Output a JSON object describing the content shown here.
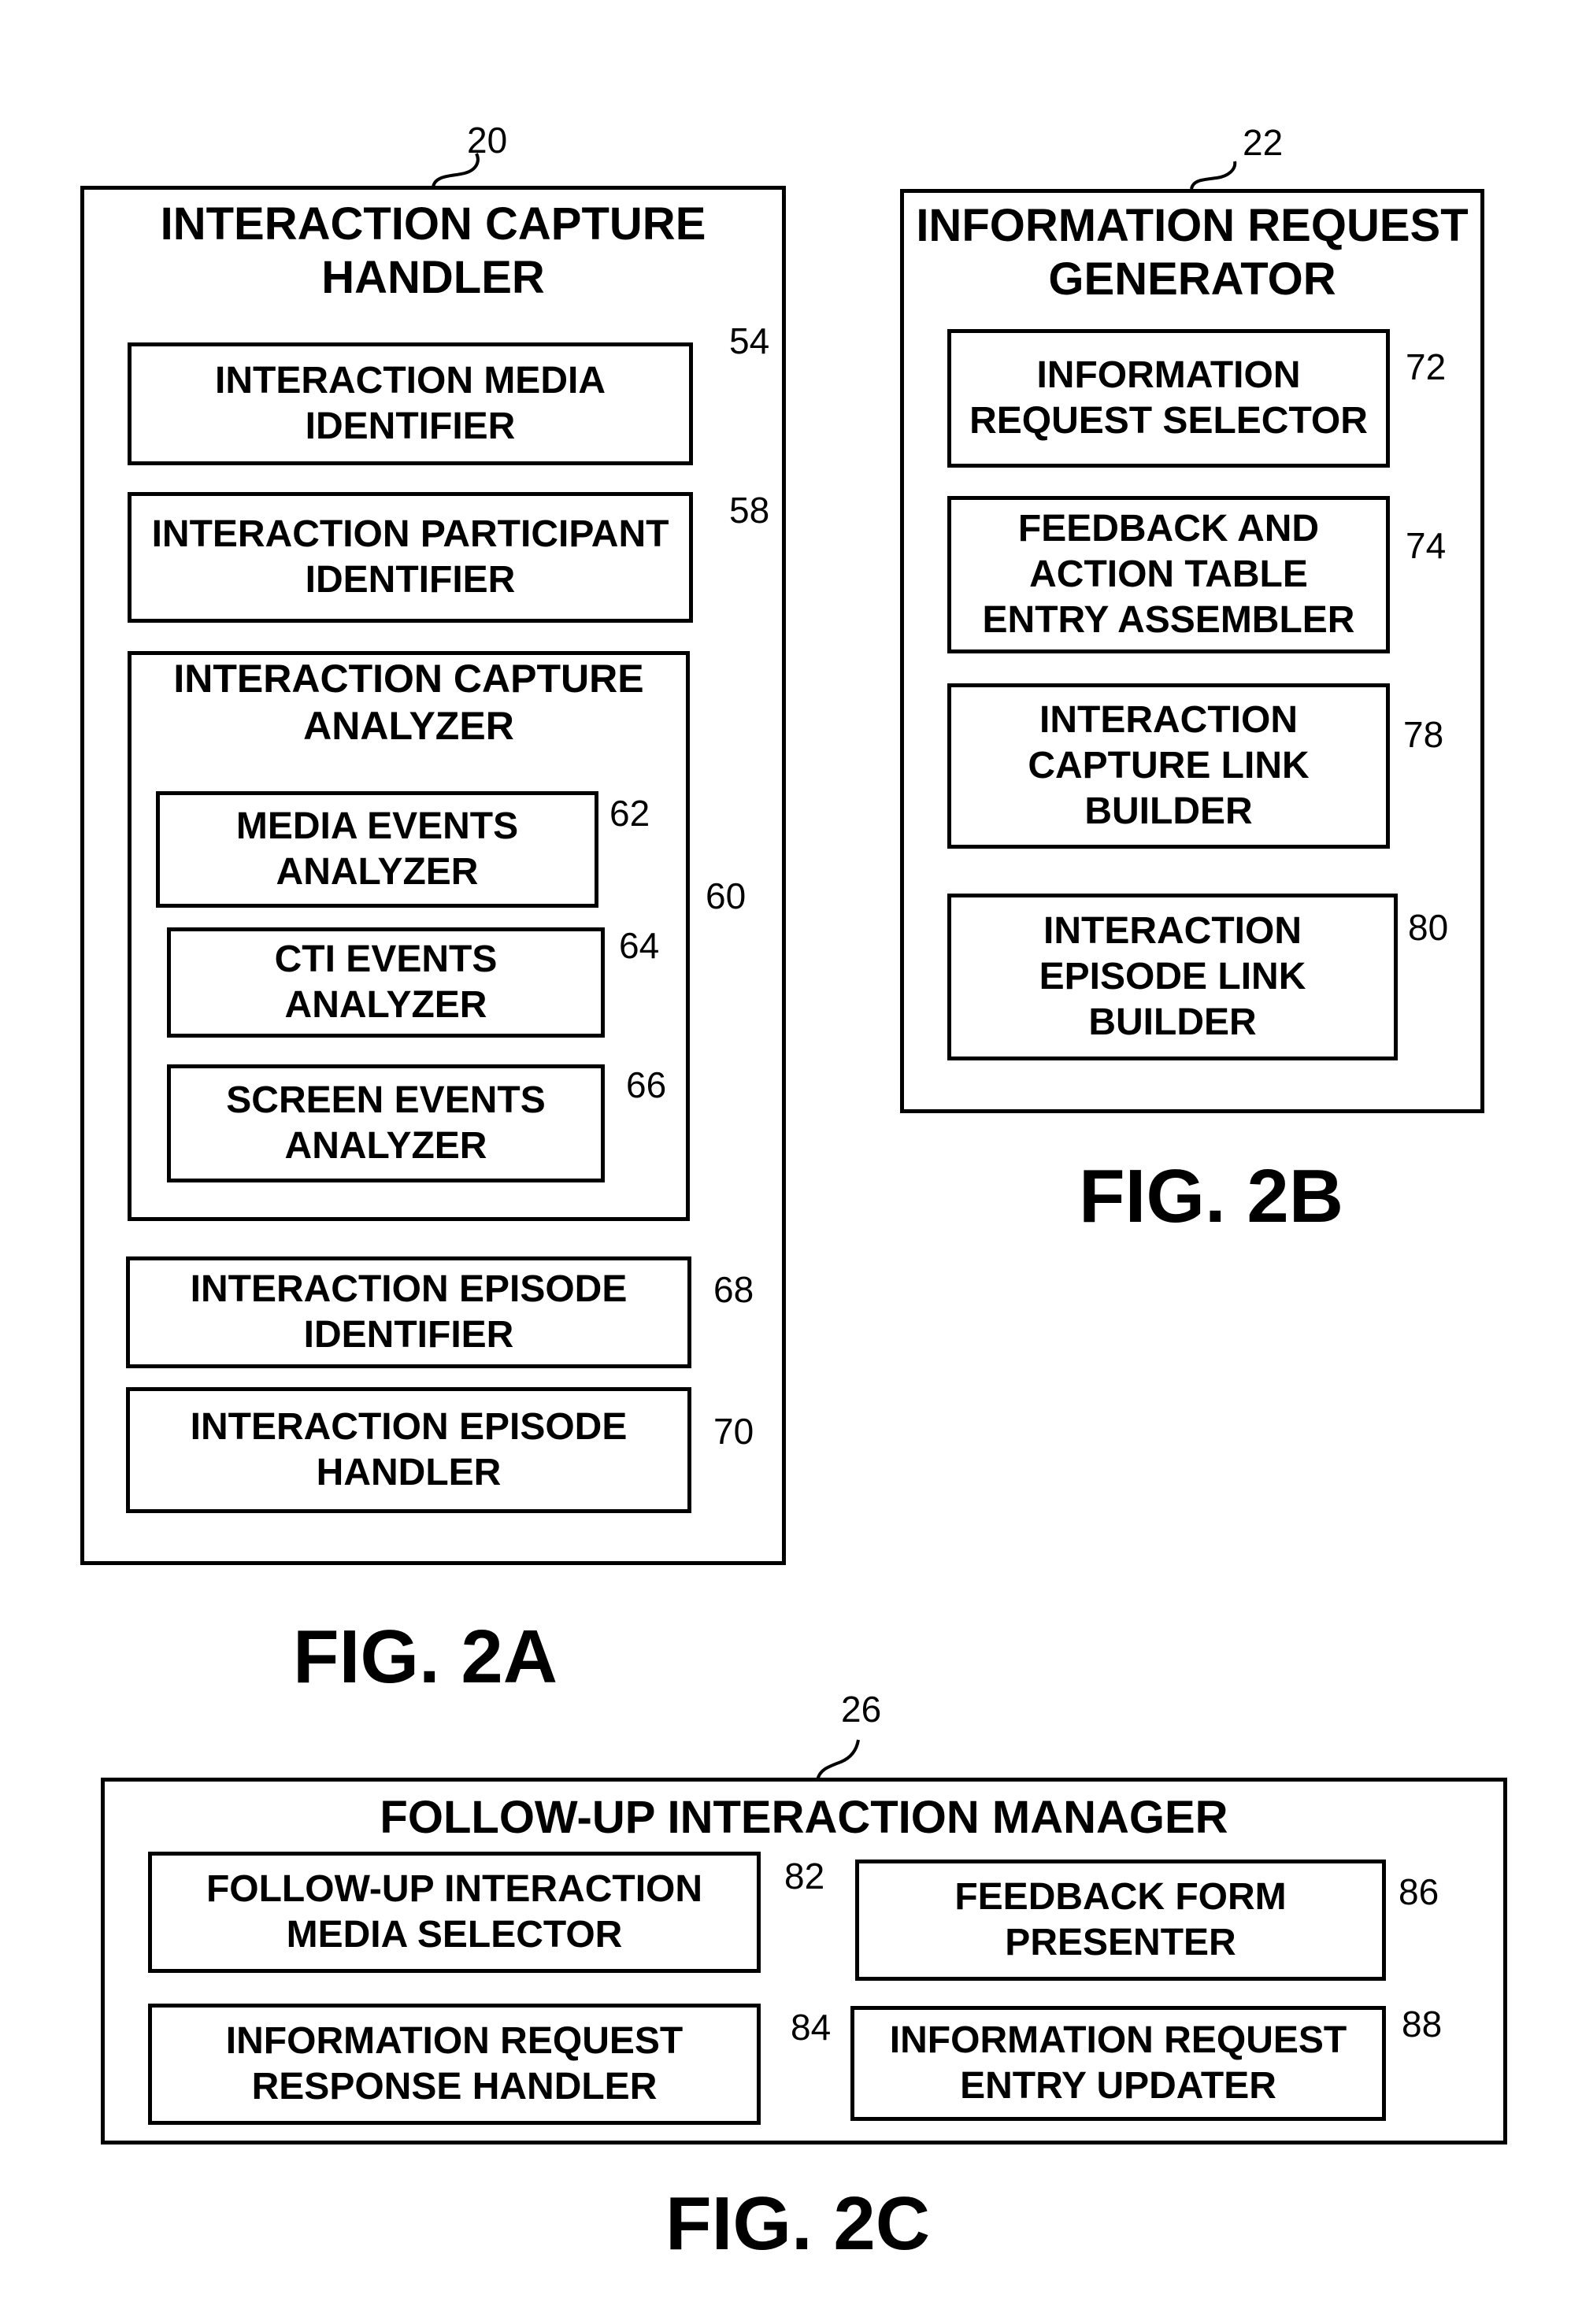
{
  "fig2a": {
    "caption": "FIG. 2A",
    "ref": "20",
    "title": "INTERACTION CAPTURE\nHANDLER",
    "media_identifier": {
      "label": "INTERACTION MEDIA\nIDENTIFIER",
      "ref": "54"
    },
    "participant_identifier": {
      "label": "INTERACTION PARTICIPANT\nIDENTIFIER",
      "ref": "58"
    },
    "capture_analyzer": {
      "title": "INTERACTION CAPTURE\nANALYZER",
      "ref": "60",
      "media_events": {
        "label": "MEDIA EVENTS\nANALYZER",
        "ref": "62"
      },
      "cti_events": {
        "label": "CTI EVENTS\nANALYZER",
        "ref": "64"
      },
      "screen_events": {
        "label": "SCREEN EVENTS\nANALYZER",
        "ref": "66"
      }
    },
    "episode_identifier": {
      "label": "INTERACTION EPISODE\nIDENTIFIER",
      "ref": "68"
    },
    "episode_handler": {
      "label": "INTERACTION EPISODE\nHANDLER",
      "ref": "70"
    }
  },
  "fig2b": {
    "caption": "FIG. 2B",
    "ref": "22",
    "title": "INFORMATION REQUEST\nGENERATOR",
    "request_selector": {
      "label": "INFORMATION\nREQUEST SELECTOR",
      "ref": "72"
    },
    "table_entry_assembler": {
      "label": "FEEDBACK AND\nACTION TABLE\nENTRY ASSEMBLER",
      "ref": "74"
    },
    "capture_link_builder": {
      "label": "INTERACTION\nCAPTURE LINK\nBUILDER",
      "ref": "78"
    },
    "episode_link_builder": {
      "label": "INTERACTION\nEPISODE LINK\nBUILDER",
      "ref": "80"
    }
  },
  "fig2c": {
    "caption": "FIG. 2C",
    "ref": "26",
    "title": "FOLLOW-UP INTERACTION MANAGER",
    "media_selector": {
      "label": "FOLLOW-UP INTERACTION\nMEDIA SELECTOR",
      "ref": "82"
    },
    "response_handler": {
      "label": "INFORMATION REQUEST\nRESPONSE HANDLER",
      "ref": "84"
    },
    "feedback_form_presenter": {
      "label": "FEEDBACK FORM\nPRESENTER",
      "ref": "86"
    },
    "entry_updater": {
      "label": "INFORMATION REQUEST\nENTRY UPDATER",
      "ref": "88"
    }
  }
}
